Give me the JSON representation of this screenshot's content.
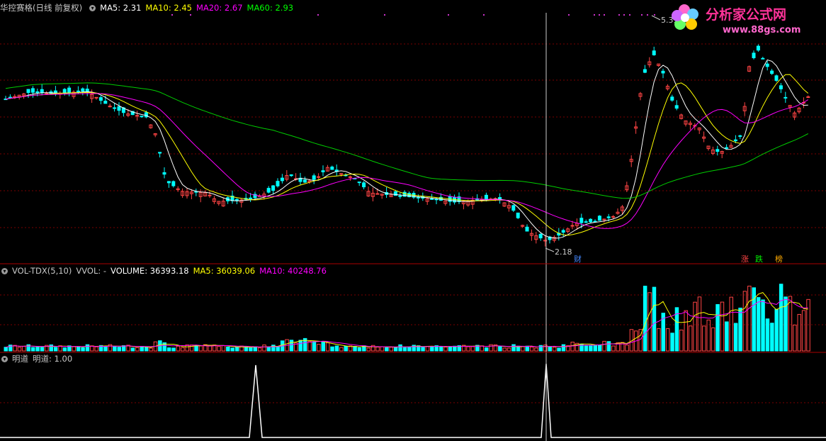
{
  "main_header": {
    "title": "华控赛格(日线 前复权)",
    "ma5": "MA5: 2.31",
    "ma10": "MA10: 2.45",
    "ma20": "MA20: 2.67",
    "ma60": "MA60: 2.93"
  },
  "vol_header": {
    "title": "VOL-TDX(5,10)",
    "vvol": "VVOL: -",
    "volume": "VOLUME: 36393.18",
    "ma5": "MA5: 36039.06",
    "ma10": "MA10: 40248.76"
  },
  "ind_header": {
    "title": "明道",
    "value": "明道: 1.00"
  },
  "annotations": {
    "high_price": "5.39",
    "low_price": "2.18",
    "cai_badge": "财",
    "zhang": "涨",
    "die": "跌",
    "bang": "榜"
  },
  "logo": {
    "name": "分析家公式网",
    "url": "www.88gs.com"
  },
  "colors": {
    "up": "#ff4444",
    "down": "#00ffff",
    "ma5": "#ffffff",
    "ma10": "#ffff00",
    "ma20": "#ff00ff",
    "ma60": "#00cc00",
    "grid": "#7a0000"
  }
}
